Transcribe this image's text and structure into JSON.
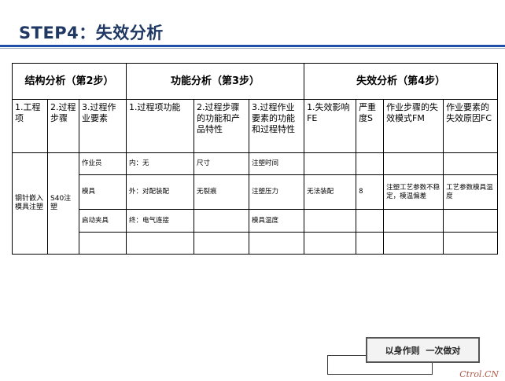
{
  "title": "STEP4：失效分析",
  "sections": {
    "structure": "结构分析（第2步）",
    "function": "功能分析（第3步）",
    "failure": "失效分析（第4步）"
  },
  "headers": [
    "1.工程项",
    "2.过程步骤",
    "3.过程作业要素",
    "1.过程项功能",
    "2.过程步骤的功能和产品特性",
    "3.过程作业要素的功能和过程特性",
    "1.失效影响FE",
    "严重度S",
    "作业步骤的失效模式FM",
    "作业要素的失效原因FC"
  ],
  "rows": [
    {
      "element": "作业员",
      "item_function": "内：无",
      "step_function": "尺寸",
      "element_function": "注塑时间",
      "fe": "",
      "s": "",
      "fm": "",
      "fc": ""
    },
    {
      "element": "模具",
      "item_function": "外：对配装配",
      "step_function": "无裂痕",
      "element_function": "注塑压力",
      "fe": "无法装配",
      "s": "8",
      "fm": "注塑工艺参数不稳定，模温偏差",
      "fc": "工艺参数模具温度"
    },
    {
      "element": "启动夹具",
      "item_function": "终：电气连接",
      "step_function": "",
      "element_function": "模具温度",
      "fe": "",
      "s": "",
      "fm": "",
      "fc": ""
    },
    {
      "element": "",
      "item_function": "",
      "step_function": "",
      "element_function": "",
      "fe": "",
      "s": "",
      "fm": "",
      "fc": ""
    }
  ],
  "process_item": "钢针嵌入模具注塑",
  "process_step": "S40注塑",
  "motto": "以身作则  一次做对",
  "watermark": "Ctrol.CN"
}
